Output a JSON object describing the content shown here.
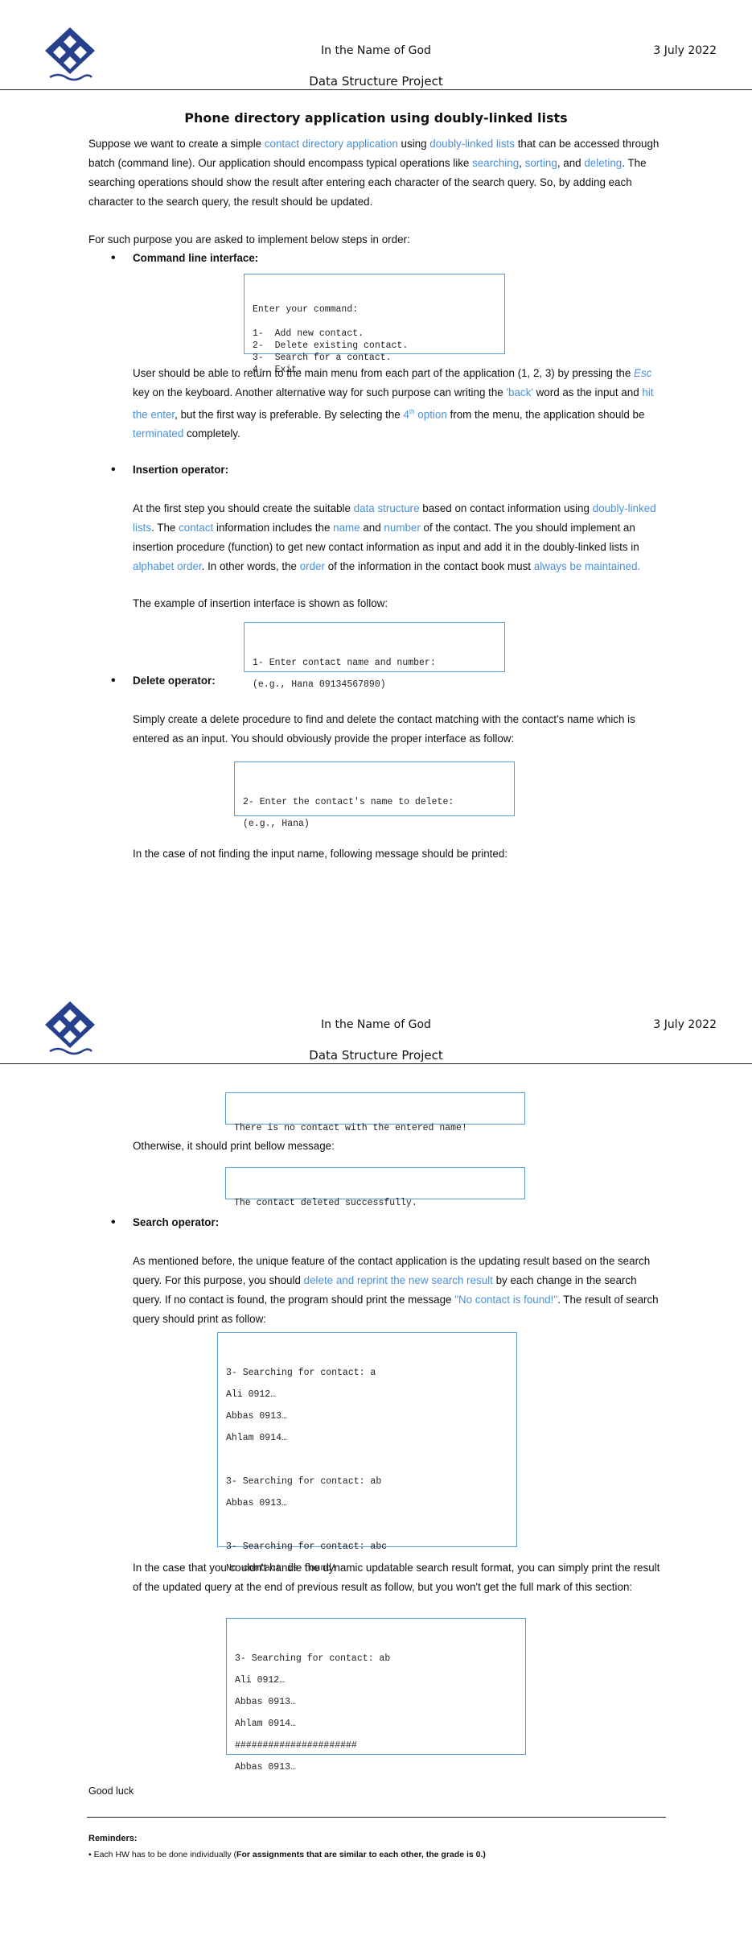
{
  "header": {
    "in_name_of_god": "In the Name of God",
    "date": "3 July 2022",
    "project": "Data Structure Project"
  },
  "title": "Phone directory application using doubly-linked lists",
  "intro": {
    "t1": "Suppose we want to create a simple ",
    "b1": "contact directory application",
    "t2": " using ",
    "b2": "doubly-linked lists",
    "t3": " that can be accessed through batch (command line). Our application should encompass typical operations like ",
    "b3": "searching",
    "t4": ", ",
    "b4": "sorting",
    "t5": ", and ",
    "b5": "deleting",
    "t6": ". The searching operations should show the result after entering each character of the search query. So, by adding each character to the search query, the result should be updated."
  },
  "steps_intro": "For such purpose you are asked to implement below steps in order:",
  "cli": {
    "heading": "Command line interface:",
    "code": [
      "Enter your command:",
      "",
      "1-  Add new contact.",
      "2-  Delete existing contact.",
      "3-  Search for a contact.",
      "4-  Exit."
    ],
    "p_t1": "User should be able to return to the main menu from each part of the application (1, 2, 3) by pressing the ",
    "p_b1": "Esc",
    "p_t2": " key on the keyboard. Another alternative way for such purpose can writing the ",
    "p_b2": "'back'",
    "p_t3": " word as the input and ",
    "p_b3": "hit the enter",
    "p_t4": ", but the first way is preferable. By selecting the ",
    "p_b4": "4",
    "p_b4sup": "th",
    "p_b4b": " option",
    "p_t5": " from the menu, the application should be ",
    "p_b5": "terminated",
    "p_t6": " completely."
  },
  "insertion": {
    "heading": "Insertion operator:",
    "p_t1": "At the first step you should create the suitable ",
    "p_b1": "data structure",
    "p_t2": " based on contact information using ",
    "p_b2": "doubly-linked lists",
    "p_t3": ". The ",
    "p_b3": "contact",
    "p_t4": " information includes the ",
    "p_b4": "name",
    "p_t5": " and ",
    "p_b5": "number",
    "p_t6": " of the contact. The you should implement an insertion procedure (function) to get new contact information as input and add it in the doubly-linked lists in ",
    "p_b6": "alphabet order",
    "p_t7": ". In other words, the ",
    "p_b7": "order",
    "p_t8": " of the information in the contact book must ",
    "p_b8": "always be maintained.",
    "example": "The example of insertion interface is shown as follow:",
    "code": [
      "1- Enter contact name and number:",
      "(e.g., Hana 09134567890)"
    ]
  },
  "delete": {
    "heading": "Delete operator:",
    "p": "Simply create a delete procedure to find and delete the contact matching with the contact's name which is entered as an input. You should obviously provide the proper interface as follow:",
    "code": [
      "2- Enter the contact's name to delete:",
      "(e.g., Hana)"
    ],
    "not_found": "In the case of not finding the input name, following message should be printed:",
    "code_not_found": "There is no contact with the entered name!",
    "otherwise": "Otherwise, it should print bellow message:",
    "code_ok": "The contact deleted successfully."
  },
  "search": {
    "heading": "Search operator:",
    "p_t1": "As mentioned before, the unique feature of the contact application is the updating result based on the search query. For this purpose, you should ",
    "p_b1": "delete and reprint the new search result",
    "p_t2": " by each change in the search query. If no contact is found, the program should print the message ",
    "p_b2": "\"No contact is found!\"",
    "p_t3": ". The result of search query should print as follow:",
    "code": [
      "3- Searching for contact: a",
      "Ali 0912…",
      "Abbas 0913…",
      "Ahlam 0914…",
      "",
      "3- Searching for contact: ab",
      "Abbas 0913…",
      "",
      "3- Searching for contact: abc",
      "No contact is found!"
    ],
    "fallback": "In the case that you couldn't handle the dynamic updatable search result format, you can simply print the result of the updated query at the end of previous result as follow, but you won't get the full mark of this section:",
    "code2": [
      "3- Searching for contact: ab",
      "Ali 0912…",
      "Abbas 0913…",
      "Ahlam 0914…",
      "######################",
      "Abbas 0913…"
    ]
  },
  "good_luck": "Good luck",
  "reminders": {
    "title": "Reminders:",
    "item_t1": "• Each HW has to be done individually (",
    "item_b1": "For assignments that are similar to each other, the grade is 0.)"
  },
  "colors": {
    "link": "#4a90d9",
    "box_border": "#5b9bd5",
    "logo": "#27408b"
  }
}
